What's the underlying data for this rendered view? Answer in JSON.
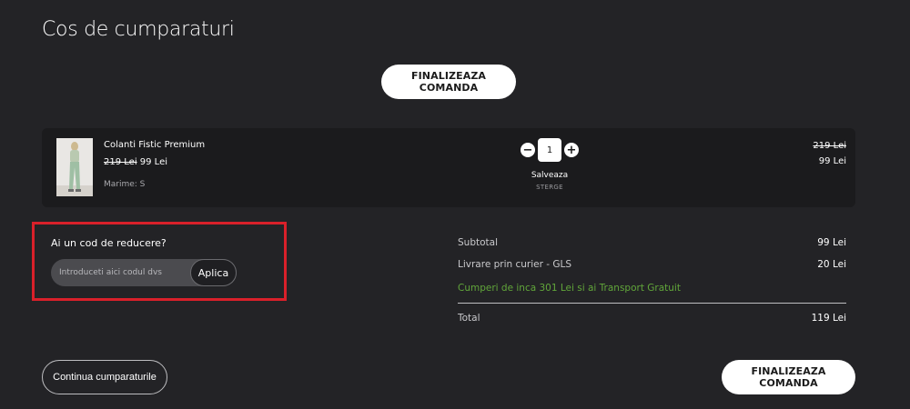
{
  "page": {
    "title": "Cos de cumparaturi"
  },
  "checkout": {
    "label": "FINALIZEAZA COMANDA"
  },
  "cart": {
    "items": [
      {
        "name": "Colanti Fistic Premium",
        "old_price": "219 Lei",
        "price": "99 Lei",
        "size": "Marime: S",
        "quantity": "1",
        "save_label": "Salveaza",
        "delete_label": "STERGE",
        "row_old_price": "219 Lei",
        "row_price": "99 Lei"
      }
    ]
  },
  "coupon": {
    "label": "Ai un cod de reducere?",
    "placeholder": "Introduceti aici codul dvs",
    "apply_label": "Aplica"
  },
  "summary": {
    "subtotal_label": "Subtotal",
    "subtotal_value": "99 Lei",
    "shipping_label": "Livrare prin curier - GLS",
    "shipping_value": "20 Lei",
    "free_shipping_note": "Cumperi de inca 301 Lei si ai Transport Gratuit",
    "total_label": "Total",
    "total_value": "119 Lei"
  },
  "footer": {
    "continue_label": "Continua cumparaturile"
  },
  "colors": {
    "background": "#232326",
    "row_background": "#1b1b1d",
    "promo_green": "#61a63a",
    "highlight_red": "#d9202a"
  }
}
